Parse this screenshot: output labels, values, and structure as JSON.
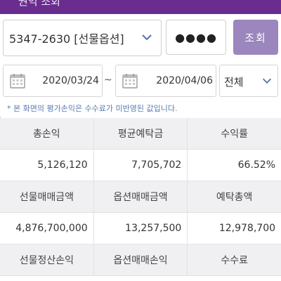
{
  "header": {
    "title": "권익 조회"
  },
  "account": {
    "selected": "5347-2630 [선물옵션]"
  },
  "password": {
    "masked": "●●●●"
  },
  "query_button": {
    "label": "조회"
  },
  "date_range": {
    "start": "2020/03/24",
    "separator": "~",
    "end": "2020/04/06"
  },
  "filter": {
    "selected": "전체"
  },
  "note": "* 본 화면의 평가손익은 수수료가 미반영된 값입니다.",
  "summary": {
    "row1_headers": [
      "총손익",
      "평균예탁금",
      "수익률"
    ],
    "row1_values": [
      "5,126,120",
      "7,705,702",
      "66.52%"
    ],
    "row2_headers": [
      "선물매매금액",
      "옵션매매금액",
      "예탁총액"
    ],
    "row2_values": [
      "4,876,700,000",
      "13,257,500",
      "12,978,700"
    ],
    "row3_headers": [
      "선물정산손익",
      "옵션매매손익",
      "수수료"
    ]
  },
  "colors": {
    "brand": "#6a2c8f",
    "button": "#9b86bd",
    "positive": "#c2336e",
    "note": "#5a7bb0"
  },
  "icons": {
    "calendar": "calendar-icon",
    "dropdown": "chevron-down-icon"
  }
}
